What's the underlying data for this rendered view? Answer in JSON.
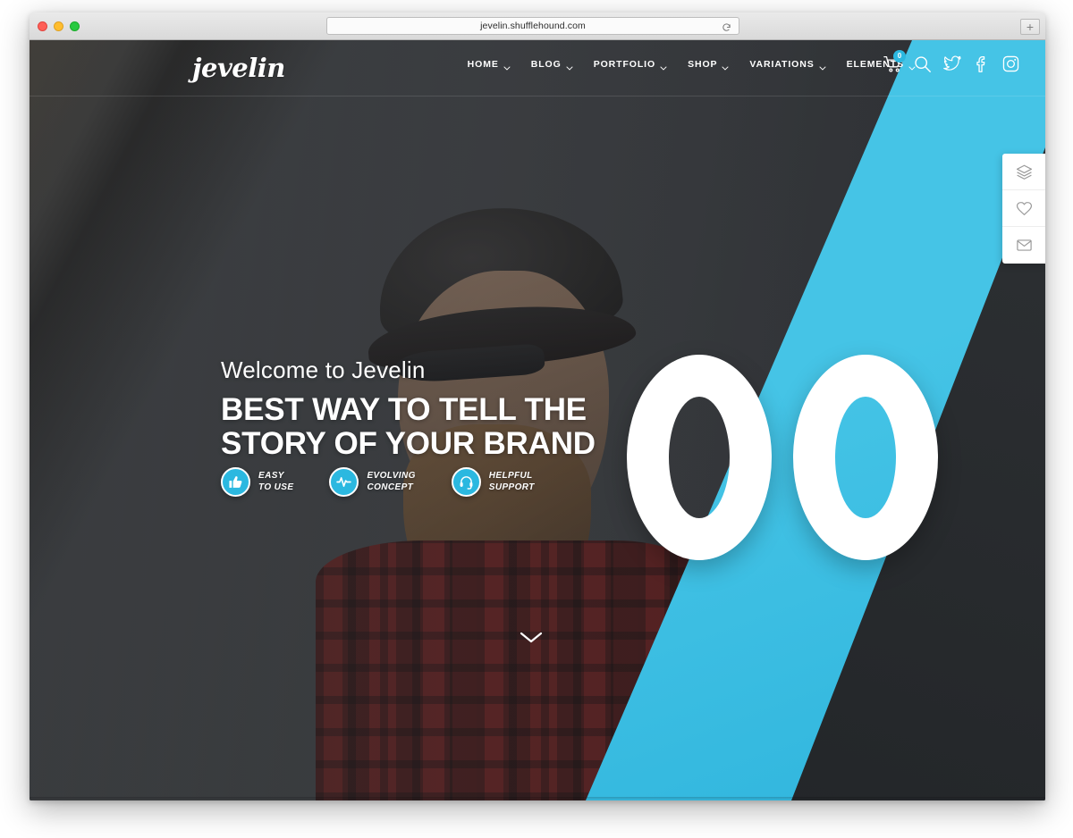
{
  "browser": {
    "url": "jevelin.shufflehound.com",
    "reload_icon": "reload-icon",
    "new_tab_label": "+",
    "traffic_lights": [
      "close",
      "minimize",
      "zoom"
    ]
  },
  "site": {
    "logo_text": "jevelin",
    "nav": [
      {
        "label": "HOME",
        "has_dropdown": true
      },
      {
        "label": "BLOG",
        "has_dropdown": true
      },
      {
        "label": "PORTFOLIO",
        "has_dropdown": true
      },
      {
        "label": "SHOP",
        "has_dropdown": true
      },
      {
        "label": "VARIATIONS",
        "has_dropdown": true
      },
      {
        "label": "ELEMENTS",
        "has_dropdown": true
      }
    ],
    "nav_icons": [
      {
        "name": "cart-icon",
        "badge": "0"
      },
      {
        "name": "search-icon"
      },
      {
        "name": "twitter-icon"
      },
      {
        "name": "facebook-icon"
      },
      {
        "name": "instagram-icon"
      }
    ]
  },
  "hero": {
    "eyebrow": "Welcome to Jevelin",
    "headline_line1": "BEST WAY TO TELL THE",
    "headline_line2": "STORY OF YOUR BRAND",
    "features": [
      {
        "icon": "thumbs-up-icon",
        "line1": "EASY",
        "line2": "TO USE"
      },
      {
        "icon": "pulse-icon",
        "line1": "EVOLVING",
        "line2": "CONCEPT"
      },
      {
        "icon": "headset-icon",
        "line1": "HELPFUL",
        "line2": "SUPPORT"
      }
    ],
    "scroll_indicator": "chevron-down-icon",
    "decoration_text": "OO"
  },
  "side_panel": [
    {
      "name": "layers-icon"
    },
    {
      "name": "heart-icon"
    },
    {
      "name": "mail-icon"
    }
  ],
  "colors": {
    "accent_cyan": "#45c4e6",
    "accent_cyan_dark": "#2fb5dd",
    "badge_cyan": "#2bb8e0",
    "hero_dark": "#3a3d40",
    "white": "#ffffff"
  }
}
